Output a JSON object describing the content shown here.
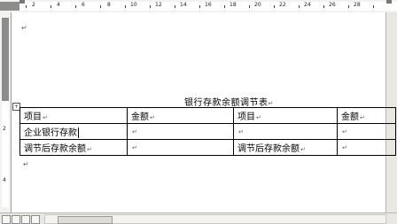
{
  "ruler": {
    "numbers": [
      "2",
      "4",
      "6",
      "8",
      "10",
      "12",
      "14",
      "16",
      "18",
      "20",
      "22",
      "24",
      "26",
      "28"
    ],
    "left_numbers": [
      "2",
      "4"
    ]
  },
  "document": {
    "title": "银行存款余额调节表",
    "table": {
      "rows": [
        [
          "项目",
          "金额",
          "项目",
          "金额"
        ],
        [
          "企业银行存款",
          "",
          "",
          ""
        ],
        [
          "调节后存款余额",
          "",
          "调节后存款余额",
          ""
        ]
      ]
    }
  }
}
